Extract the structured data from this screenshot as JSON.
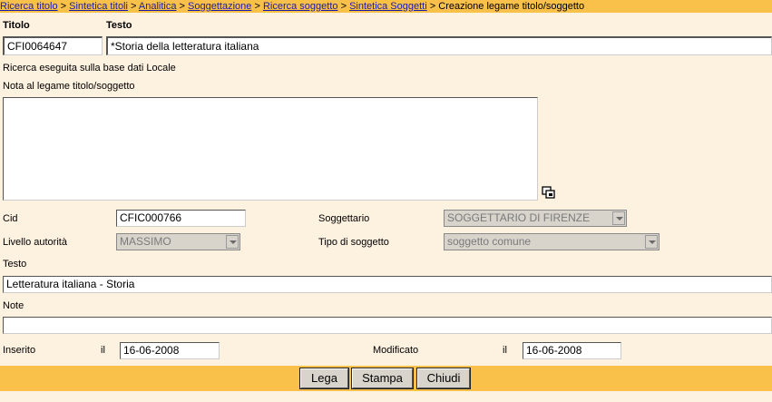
{
  "breadcrumb": {
    "links": [
      "Ricerca titolo",
      "Sintetica titoli",
      "Analitica",
      "Soggettazione",
      "Ricerca soggetto",
      "Sintetica Soggetti"
    ],
    "current": "Creazione legame titolo/soggetto",
    "separator": ">"
  },
  "header": {
    "titolo_label": "Titolo",
    "testo_label": "Testo",
    "titolo_value": "CFI0064647",
    "testo_value": "*Storia della letteratura italiana"
  },
  "search_info": "Ricerca eseguita sulla base dati Locale",
  "nota_label": "Nota al legame titolo/soggetto",
  "nota_value": "",
  "form": {
    "cid_label": "Cid",
    "cid_value": "CFIC000766",
    "soggettario_label": "Soggettario",
    "soggettario_value": "SOGGETTARIO DI FIRENZE",
    "livello_label": "Livello autorità",
    "livello_value": "MASSIMO",
    "tipo_label": "Tipo di soggetto",
    "tipo_value": "soggetto comune",
    "testo_label": "Testo",
    "testo_value": "Letteratura italiana - Storia",
    "note_label": "Note",
    "note_value": "",
    "inserito_label": "Inserito",
    "inserito_il": "il",
    "inserito_value": "16-06-2008",
    "modificato_label": "Modificato",
    "modificato_il": "il",
    "modificato_value": "16-06-2008"
  },
  "buttons": {
    "lega": "Lega",
    "stampa": "Stampa",
    "chiudi": "Chiudi"
  },
  "colors": {
    "bar": "#f9c04a",
    "background": "#fdf1e0",
    "link": "#1a1aa6"
  }
}
